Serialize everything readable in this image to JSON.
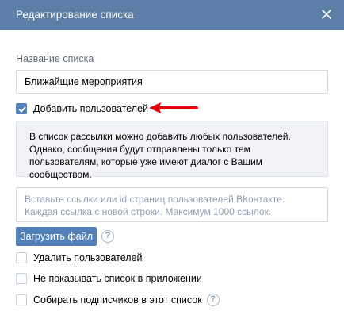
{
  "dialog": {
    "title": "Редактирование списка",
    "close_icon": "close-icon"
  },
  "list_name": {
    "label": "Название списка",
    "value": "Ближайщие мероприятия"
  },
  "add_users": {
    "label": "Добавить пользователей",
    "checked": true
  },
  "info_text": "В список рассылки можно добавить любых пользователей. Однако, сообщения будут отправлены только тем пользователям, которые уже имеют диалог с Вашим сообществом.",
  "links_input": {
    "value": "",
    "placeholder": "Вставьте ссылки или id страниц пользователей ВКонтакте. Каждая ссылка с новой строки. Максимум 1000 ссылок."
  },
  "upload_button": {
    "label": "Загрузить файл",
    "help_glyph": "?"
  },
  "options": {
    "remove_users": {
      "label": "Удалить пользователей",
      "checked": false
    },
    "hide_in_app": {
      "label": "Не показывать список в приложении",
      "checked": false
    },
    "collect_subscribers": {
      "label": "Собирать подписчиков в этот список",
      "checked": false,
      "help_glyph": "?"
    }
  },
  "colors": {
    "header_bg": "#5b7fa6",
    "accent": "#5181b8",
    "arrow": "#e3000f"
  }
}
